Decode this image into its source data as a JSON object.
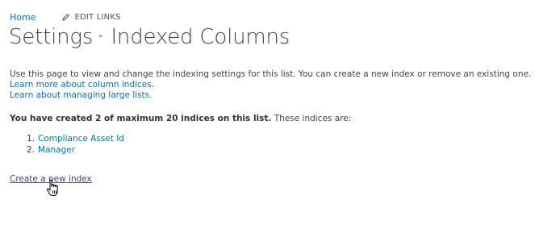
{
  "nav": {
    "home": "Home",
    "edit_links": "EDIT LINKS"
  },
  "header": {
    "parent": "Settings",
    "title": "Indexed Columns"
  },
  "description": {
    "text": "Use this page to view and change the indexing settings for this list. You can create a new index or remove an existing one.",
    "link1": "Learn more about column indices.",
    "link2": "Learn about managing large lists."
  },
  "summary": {
    "bold": "You have created 2 of maximum 20 indices on this list.",
    "rest": " These indices are:"
  },
  "indices": [
    {
      "num": "1.",
      "label": "Compliance Asset Id"
    },
    {
      "num": "2.",
      "label": "Manager"
    }
  ],
  "create_link": "Create a new index",
  "colors": {
    "link": "#0072c6",
    "text": "#444444"
  },
  "icons": {
    "edit": "pencil-icon",
    "cursor": "hand-pointer-cursor"
  }
}
